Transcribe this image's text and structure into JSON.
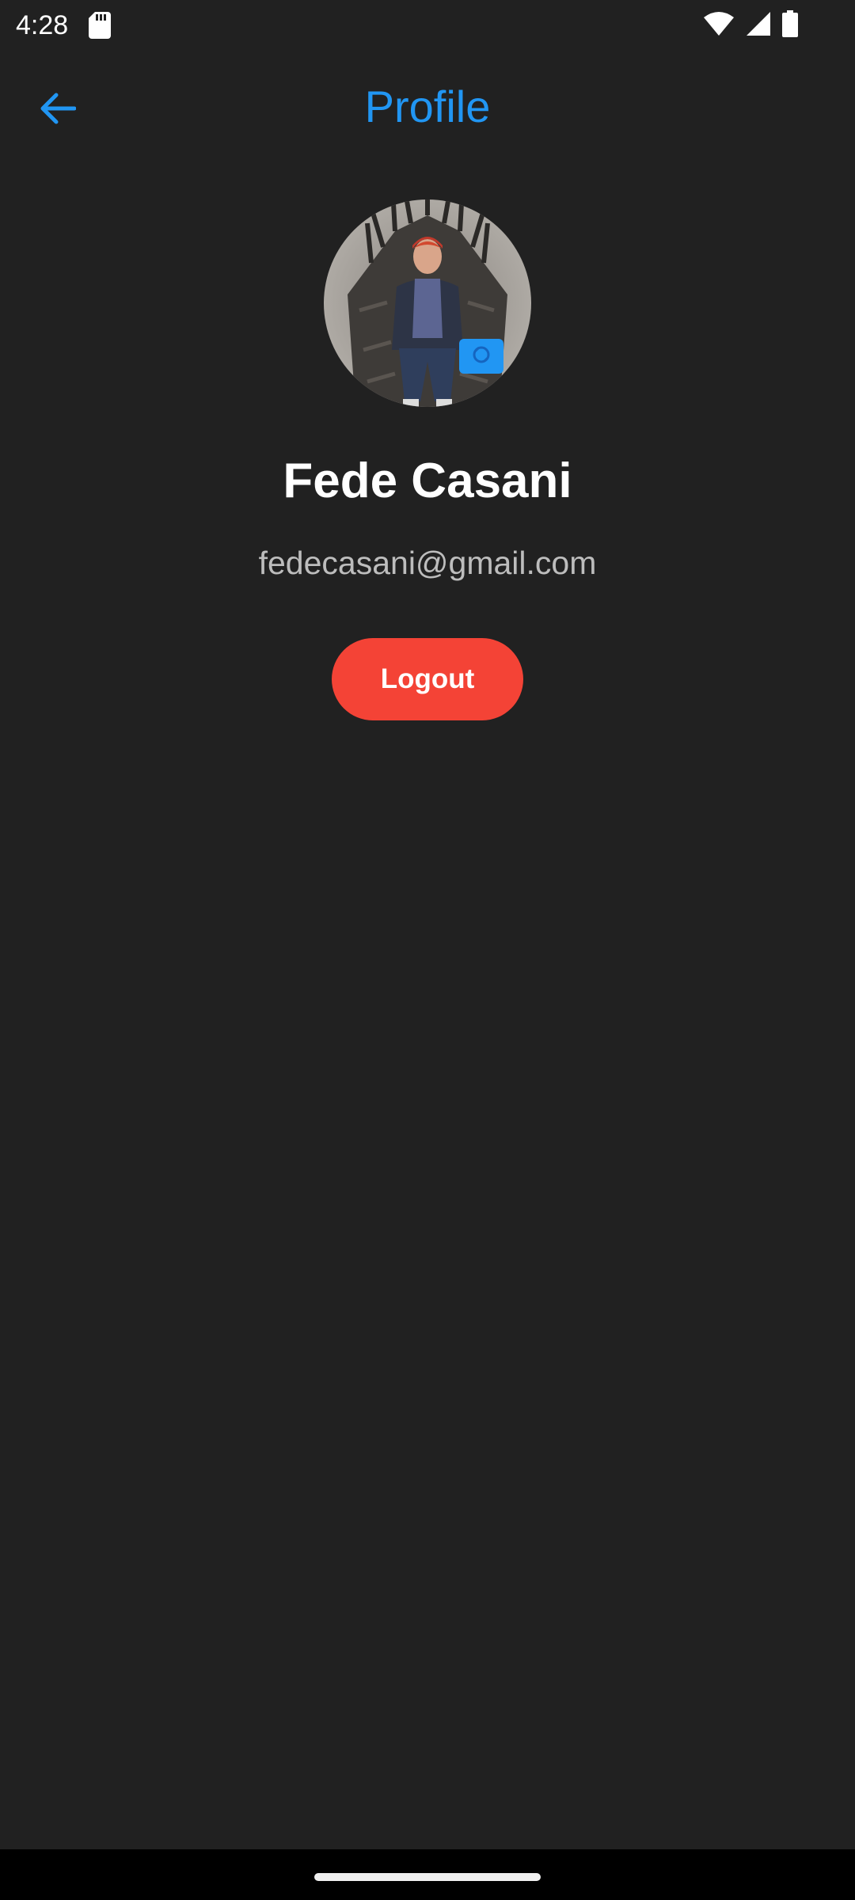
{
  "status_bar": {
    "time": "4:28",
    "icons": [
      "sd-card-icon",
      "wifi-icon",
      "signal-icon",
      "battery-icon"
    ]
  },
  "app_bar": {
    "title": "Profile",
    "back_icon": "arrow-left-icon",
    "accent_color": "#2196f3"
  },
  "profile": {
    "avatar_icon": "profile-photo",
    "camera_icon": "camera-icon",
    "name": "Fede Casani",
    "email": "fedecasani@gmail.com"
  },
  "actions": {
    "logout_label": "Logout",
    "logout_color": "#f44336"
  },
  "theme": {
    "background": "#212121",
    "text_primary": "#ffffff",
    "text_secondary": "#bdbdbd"
  }
}
